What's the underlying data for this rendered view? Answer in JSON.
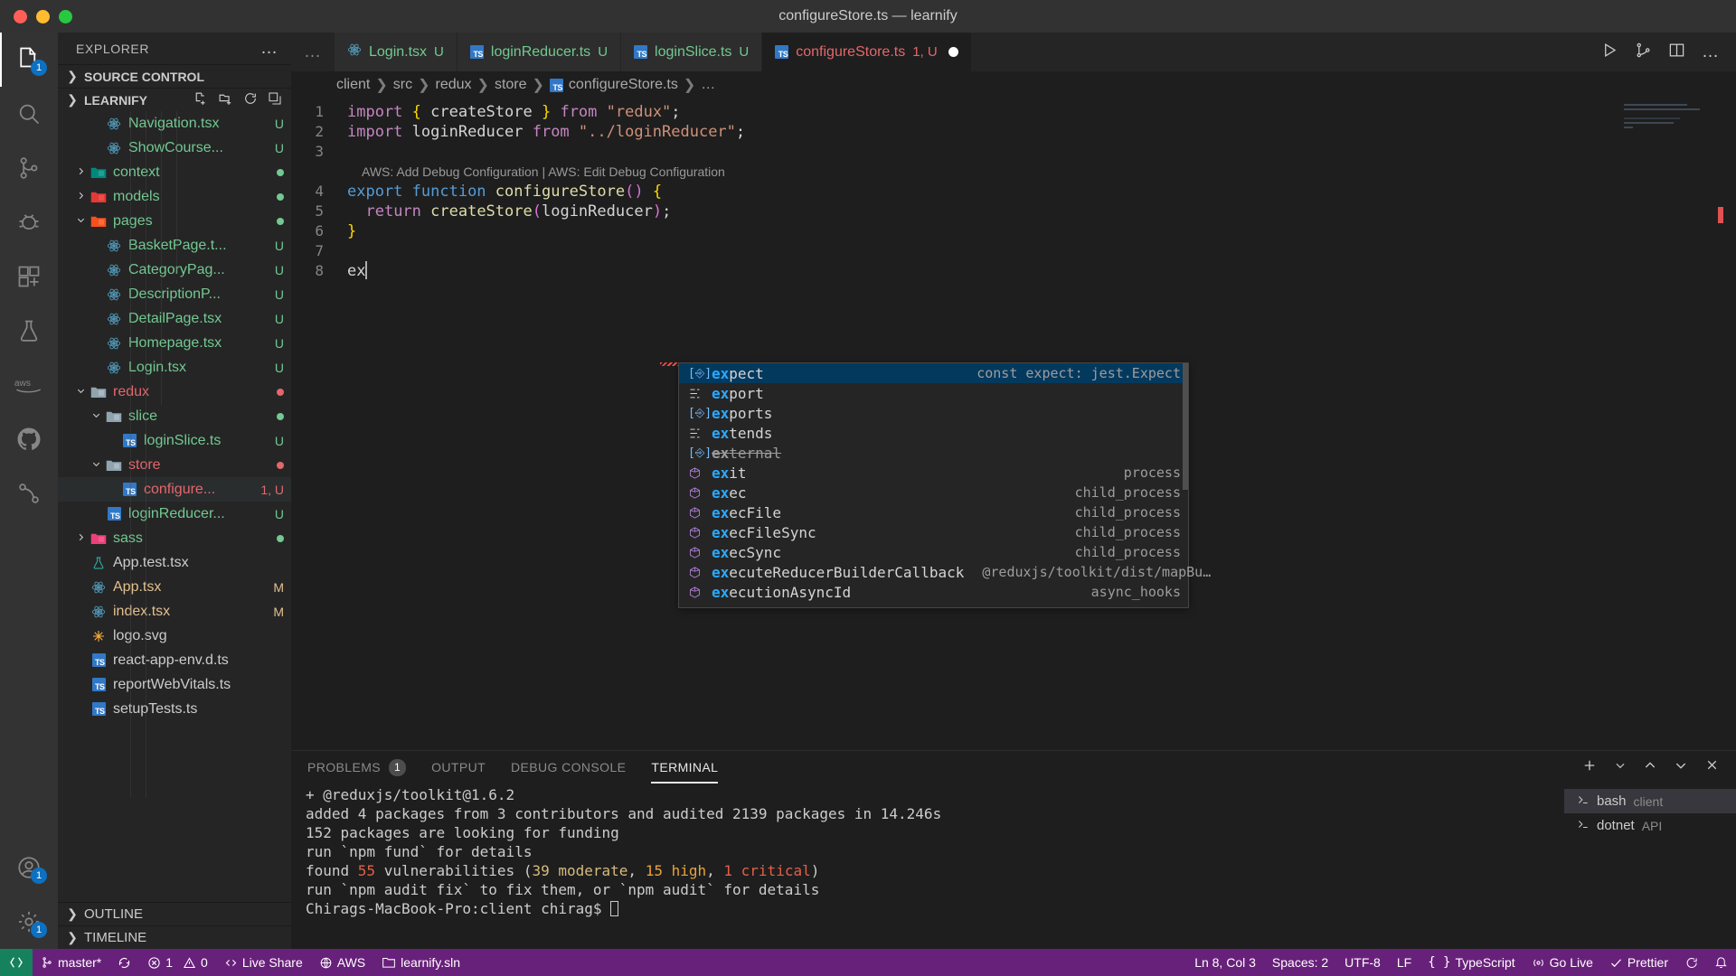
{
  "window": {
    "title": "configureStore.ts — learnify"
  },
  "activitybar": {
    "items": [
      {
        "name": "explorer",
        "icon": "files-icon",
        "badge": "1",
        "active": true
      },
      {
        "name": "search",
        "icon": "search-icon",
        "badge": "",
        "active": false
      },
      {
        "name": "source-control",
        "icon": "source-control-icon",
        "badge": "",
        "active": false
      },
      {
        "name": "run-and-debug",
        "icon": "debug-icon",
        "badge": "",
        "active": false
      },
      {
        "name": "extensions",
        "icon": "extensions-icon",
        "badge": "",
        "active": false
      },
      {
        "name": "testing",
        "icon": "beaker-icon",
        "badge": "",
        "active": false
      },
      {
        "name": "aws-toolkit",
        "icon": "aws-icon",
        "badge": "",
        "active": false
      },
      {
        "name": "github",
        "icon": "github-icon",
        "badge": "",
        "active": false
      },
      {
        "name": "remote-explorer",
        "icon": "remote-icon",
        "badge": "",
        "active": false
      }
    ],
    "bottom": [
      {
        "name": "accounts",
        "icon": "account-icon",
        "badge": "1"
      },
      {
        "name": "manage",
        "icon": "gear-icon",
        "badge": "1"
      }
    ]
  },
  "sidebar": {
    "title": "EXPLORER",
    "more_label": "…",
    "sections": [
      {
        "label": "SOURCE CONTROL",
        "expanded": false
      },
      {
        "label": "LEARNIFY",
        "expanded": true
      },
      {
        "label": "OUTLINE",
        "expanded": false
      },
      {
        "label": "TIMELINE",
        "expanded": false
      }
    ],
    "folder_actions": [
      "new-file-icon",
      "new-folder-icon",
      "refresh-icon",
      "collapse-all-icon"
    ],
    "tree": [
      {
        "label": "Navigation.tsx",
        "icon": "react",
        "indent": 4,
        "twist": "",
        "status": "U",
        "statusColor": "#73c991",
        "nameColor": "#73c991",
        "selected": false
      },
      {
        "label": "ShowCourse...",
        "icon": "react",
        "indent": 4,
        "twist": "",
        "status": "U",
        "statusColor": "#73c991",
        "nameColor": "#73c991",
        "selected": false
      },
      {
        "label": "context",
        "icon": "folder-context",
        "indent": 3,
        "twist": "collapsed",
        "status": "dot",
        "statusColor": "#73c991",
        "nameColor": "#73c991",
        "selected": false
      },
      {
        "label": "models",
        "icon": "folder-models",
        "indent": 3,
        "twist": "collapsed",
        "status": "dot",
        "statusColor": "#73c991",
        "nameColor": "#73c991",
        "selected": false
      },
      {
        "label": "pages",
        "icon": "folder-pages",
        "indent": 3,
        "twist": "expanded",
        "status": "dot",
        "statusColor": "#73c991",
        "nameColor": "#73c991",
        "selected": false
      },
      {
        "label": "BasketPage.t...",
        "icon": "react",
        "indent": 4,
        "twist": "",
        "status": "U",
        "statusColor": "#73c991",
        "nameColor": "#73c991",
        "selected": false
      },
      {
        "label": "CategoryPag...",
        "icon": "react",
        "indent": 4,
        "twist": "",
        "status": "U",
        "statusColor": "#73c991",
        "nameColor": "#73c991",
        "selected": false
      },
      {
        "label": "DescriptionP...",
        "icon": "react",
        "indent": 4,
        "twist": "",
        "status": "U",
        "statusColor": "#73c991",
        "nameColor": "#73c991",
        "selected": false
      },
      {
        "label": "DetailPage.tsx",
        "icon": "react",
        "indent": 4,
        "twist": "",
        "status": "U",
        "statusColor": "#73c991",
        "nameColor": "#73c991",
        "selected": false
      },
      {
        "label": "Homepage.tsx",
        "icon": "react",
        "indent": 4,
        "twist": "",
        "status": "U",
        "statusColor": "#73c991",
        "nameColor": "#73c991",
        "selected": false
      },
      {
        "label": "Login.tsx",
        "icon": "react",
        "indent": 4,
        "twist": "",
        "status": "U",
        "statusColor": "#73c991",
        "nameColor": "#73c991",
        "selected": false
      },
      {
        "label": "redux",
        "icon": "folder-plain",
        "indent": 3,
        "twist": "expanded",
        "status": "dot",
        "statusColor": "#e4676b",
        "nameColor": "#e4676b",
        "selected": false
      },
      {
        "label": "slice",
        "icon": "folder-plain",
        "indent": 4,
        "twist": "expanded",
        "status": "dot",
        "statusColor": "#73c991",
        "nameColor": "#73c991",
        "selected": false
      },
      {
        "label": "loginSlice.ts",
        "icon": "ts",
        "indent": 5,
        "twist": "",
        "status": "U",
        "statusColor": "#73c991",
        "nameColor": "#73c991",
        "selected": false
      },
      {
        "label": "store",
        "icon": "folder-plain",
        "indent": 4,
        "twist": "expanded",
        "status": "dot",
        "statusColor": "#e4676b",
        "nameColor": "#e4676b",
        "selected": false
      },
      {
        "label": "configure...",
        "icon": "ts",
        "indent": 5,
        "twist": "",
        "status": "1, U",
        "statusColor": "#e4676b",
        "nameColor": "#e4676b",
        "selected": true
      },
      {
        "label": "loginReducer...",
        "icon": "ts",
        "indent": 4,
        "twist": "",
        "status": "U",
        "statusColor": "#73c991",
        "nameColor": "#73c991",
        "selected": false
      },
      {
        "label": "sass",
        "icon": "folder-sass",
        "indent": 3,
        "twist": "collapsed",
        "status": "dot",
        "statusColor": "#73c991",
        "nameColor": "#73c991",
        "selected": false
      },
      {
        "label": "App.test.tsx",
        "icon": "beaker",
        "indent": 3,
        "twist": "",
        "status": "",
        "statusColor": "",
        "nameColor": "#cccccc",
        "selected": false
      },
      {
        "label": "App.tsx",
        "icon": "react",
        "indent": 3,
        "twist": "",
        "status": "M",
        "statusColor": "#e2c08d",
        "nameColor": "#e2c08d",
        "selected": false
      },
      {
        "label": "index.tsx",
        "icon": "react",
        "indent": 3,
        "twist": "",
        "status": "M",
        "statusColor": "#e2c08d",
        "nameColor": "#e2c08d",
        "selected": false
      },
      {
        "label": "logo.svg",
        "icon": "svg",
        "indent": 3,
        "twist": "",
        "status": "",
        "statusColor": "",
        "nameColor": "#cccccc",
        "selected": false
      },
      {
        "label": "react-app-env.d.ts",
        "icon": "ts",
        "indent": 3,
        "twist": "",
        "status": "",
        "statusColor": "",
        "nameColor": "#cccccc",
        "selected": false
      },
      {
        "label": "reportWebVitals.ts",
        "icon": "ts",
        "indent": 3,
        "twist": "",
        "status": "",
        "statusColor": "",
        "nameColor": "#cccccc",
        "selected": false
      },
      {
        "label": "setupTests.ts",
        "icon": "ts",
        "indent": 3,
        "twist": "",
        "status": "",
        "statusColor": "",
        "nameColor": "#cccccc",
        "selected": false
      }
    ]
  },
  "editor": {
    "tabs": [
      {
        "name": "Login.tsx",
        "icon": "react",
        "badge": "U",
        "active": false,
        "dirty": false,
        "badgeColor": "#73c991",
        "nameColor": "#73c991"
      },
      {
        "name": "loginReducer.ts",
        "icon": "ts",
        "badge": "U",
        "active": false,
        "dirty": false,
        "badgeColor": "#73c991",
        "nameColor": "#73c991"
      },
      {
        "name": "loginSlice.ts",
        "icon": "ts",
        "badge": "U",
        "active": false,
        "dirty": false,
        "badgeColor": "#73c991",
        "nameColor": "#73c991"
      },
      {
        "name": "configureStore.ts",
        "icon": "ts",
        "badge": "1, U",
        "active": true,
        "dirty": true,
        "badgeColor": "#e4676b",
        "nameColor": "#e4676b"
      }
    ],
    "tab_overflow": "…",
    "actions": [
      "run-icon",
      "split-terminal-icon",
      "split-editor-icon",
      "more-actions-icon"
    ],
    "breadcrumb": [
      "client",
      "src",
      "redux",
      "store",
      "configureStore.ts",
      "…"
    ],
    "codelens": "AWS: Add Debug Configuration | AWS: Edit Debug Configuration",
    "lines": [
      {
        "num": "1",
        "tokens": [
          {
            "t": "import ",
            "c": "t-ctl"
          },
          {
            "t": "{",
            "c": "t-br1"
          },
          {
            "t": " createStore ",
            "c": "t-pl"
          },
          {
            "t": "}",
            "c": "t-br1"
          },
          {
            "t": " from ",
            "c": "t-ctl"
          },
          {
            "t": "\"redux\"",
            "c": "t-str"
          },
          {
            "t": ";",
            "c": "t-pl"
          }
        ]
      },
      {
        "num": "2",
        "tokens": [
          {
            "t": "import ",
            "c": "t-ctl"
          },
          {
            "t": "loginReducer",
            "c": "t-pl"
          },
          {
            "t": " from ",
            "c": "t-ctl"
          },
          {
            "t": "\"../loginReducer\"",
            "c": "t-str"
          },
          {
            "t": ";",
            "c": "t-pl"
          }
        ]
      },
      {
        "num": "3",
        "tokens": []
      },
      {
        "num": "4",
        "tokens": [
          {
            "t": "export ",
            "c": "t-kw"
          },
          {
            "t": "function ",
            "c": "t-kw"
          },
          {
            "t": "configureStore",
            "c": "t-fn"
          },
          {
            "t": "()",
            "c": "t-br2"
          },
          {
            "t": " ",
            "c": "t-pl"
          },
          {
            "t": "{",
            "c": "t-br1"
          }
        ]
      },
      {
        "num": "5",
        "tokens": [
          {
            "t": "  ",
            "c": "t-pl"
          },
          {
            "t": "return ",
            "c": "t-ctl"
          },
          {
            "t": "createStore",
            "c": "t-fn"
          },
          {
            "t": "(",
            "c": "t-br2"
          },
          {
            "t": "loginReducer",
            "c": "t-pl"
          },
          {
            "t": ")",
            "c": "t-br2"
          },
          {
            "t": ";",
            "c": "t-pl"
          }
        ]
      },
      {
        "num": "6",
        "tokens": [
          {
            "t": "}",
            "c": "t-br1"
          }
        ]
      },
      {
        "num": "7",
        "tokens": []
      },
      {
        "num": "8",
        "tokens": [
          {
            "t": "ex",
            "c": "t-pl"
          }
        ]
      }
    ]
  },
  "suggest": {
    "items": [
      {
        "match": "ex",
        "rest": "pect",
        "icon": "const",
        "detail": "const expect: jest.Expect",
        "selected": true,
        "deprecated": false
      },
      {
        "match": "ex",
        "rest": "port",
        "icon": "keyword",
        "detail": "",
        "selected": false,
        "deprecated": false
      },
      {
        "match": "ex",
        "rest": "ports",
        "icon": "const",
        "detail": "",
        "selected": false,
        "deprecated": false
      },
      {
        "match": "ex",
        "rest": "tends",
        "icon": "keyword",
        "detail": "",
        "selected": false,
        "deprecated": false
      },
      {
        "match": "ex",
        "rest": "ternal",
        "icon": "const",
        "detail": "",
        "selected": false,
        "deprecated": true
      },
      {
        "match": "ex",
        "rest": "it",
        "icon": "module",
        "detail": "process",
        "selected": false,
        "deprecated": false
      },
      {
        "match": "ex",
        "rest": "ec",
        "icon": "module",
        "detail": "child_process",
        "selected": false,
        "deprecated": false
      },
      {
        "match": "ex",
        "rest": "ecFile",
        "icon": "module",
        "detail": "child_process",
        "selected": false,
        "deprecated": false
      },
      {
        "match": "ex",
        "rest": "ecFileSync",
        "icon": "module",
        "detail": "child_process",
        "selected": false,
        "deprecated": false
      },
      {
        "match": "ex",
        "rest": "ecSync",
        "icon": "module",
        "detail": "child_process",
        "selected": false,
        "deprecated": false
      },
      {
        "match": "ex",
        "rest": "ecuteReducerBuilderCallback",
        "icon": "module",
        "detail": "@reduxjs/toolkit/dist/mapBu…",
        "selected": false,
        "deprecated": false
      },
      {
        "match": "ex",
        "rest": "ecutionAsyncId",
        "icon": "module",
        "detail": "async_hooks",
        "selected": false,
        "deprecated": false
      }
    ]
  },
  "panel": {
    "tabs": [
      {
        "label": "PROBLEMS",
        "badge": "1",
        "active": false
      },
      {
        "label": "OUTPUT",
        "badge": "",
        "active": false
      },
      {
        "label": "DEBUG CONSOLE",
        "badge": "",
        "active": false
      },
      {
        "label": "TERMINAL",
        "badge": "",
        "active": true
      }
    ],
    "actions": [
      "add-terminal-icon",
      "terminal-dropdown-icon",
      "split-panel-icon",
      "maximize-panel-icon",
      "close-panel-icon"
    ],
    "terminal_lines": [
      [
        {
          "t": "+ @reduxjs/toolkit@1.6.2",
          "c": ""
        }
      ],
      [
        {
          "t": "added 4 packages from 3 contributors and audited 2139 packages in 14.246s",
          "c": ""
        }
      ],
      [
        {
          "t": "",
          "c": ""
        }
      ],
      [
        {
          "t": "152 packages are looking for funding",
          "c": ""
        }
      ],
      [
        {
          "t": "  run `npm fund` for details",
          "c": ""
        }
      ],
      [
        {
          "t": "",
          "c": ""
        }
      ],
      [
        {
          "t": "found ",
          "c": ""
        },
        {
          "t": "55",
          "c": "num-red"
        },
        {
          "t": " vulnerabilities (",
          "c": ""
        },
        {
          "t": "39 moderate",
          "c": "num-yellow"
        },
        {
          "t": ", ",
          "c": ""
        },
        {
          "t": "15 high",
          "c": "num-orange"
        },
        {
          "t": ", ",
          "c": ""
        },
        {
          "t": "1 critical",
          "c": "num-red"
        },
        {
          "t": ")",
          "c": ""
        }
      ],
      [
        {
          "t": "  run `npm audit fix` to fix them, or `npm audit` for details",
          "c": ""
        }
      ],
      [
        {
          "t": "Chirags-MacBook-Pro:client chirag$ ",
          "c": ""
        }
      ]
    ],
    "terminal_list": [
      {
        "name": "bash",
        "sub": "client",
        "icon": "terminal-icon",
        "selected": true
      },
      {
        "name": "dotnet",
        "sub": "API",
        "icon": "terminal-icon",
        "selected": false
      }
    ]
  },
  "statusbar": {
    "left": [
      {
        "name": "remote-indicator",
        "icon": "remote-icon",
        "label": ""
      },
      {
        "name": "branch",
        "icon": "branch-icon",
        "label": "master*"
      },
      {
        "name": "sync",
        "icon": "sync-icon",
        "label": ""
      },
      {
        "name": "problems",
        "icon": "error-icon",
        "label": "1  0"
      },
      {
        "name": "live-share",
        "icon": "live-share-icon",
        "label": "Live Share"
      },
      {
        "name": "aws-connection",
        "icon": "aws-status-icon",
        "label": "AWS"
      },
      {
        "name": "solution",
        "icon": "solution-icon",
        "label": "learnify.sln"
      }
    ],
    "problems_errors": "1",
    "problems_warnings": "0",
    "right": [
      {
        "name": "cursor-position",
        "label": "Ln 8, Col 3"
      },
      {
        "name": "indentation",
        "label": "Spaces: 2"
      },
      {
        "name": "encoding",
        "label": "UTF-8"
      },
      {
        "name": "eol",
        "label": "LF"
      },
      {
        "name": "language-mode",
        "label": "TypeScript",
        "icon": "braces-icon"
      },
      {
        "name": "go-live",
        "label": "Go Live",
        "icon": "broadcast-icon"
      },
      {
        "name": "prettier",
        "label": "Prettier",
        "icon": "check-icon"
      },
      {
        "name": "notifications",
        "label": "",
        "icon": "bell-icon"
      }
    ]
  }
}
